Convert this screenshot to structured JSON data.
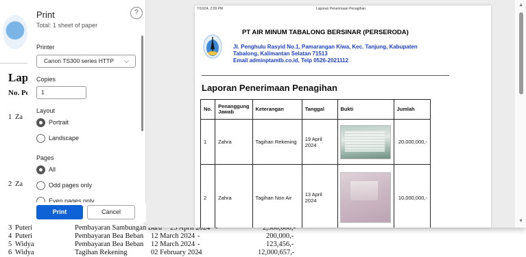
{
  "background": {
    "heading": "Lapo",
    "col_head": "No. Pe",
    "rows_top": [
      {
        "no": "1",
        "name": "Za"
      },
      {
        "no": "2",
        "name": "Za"
      }
    ],
    "rows": [
      {
        "no": "3",
        "name": "Puteri",
        "keterangan": "Pembayaran Sambungan Baru",
        "tanggal": "25 April 2024",
        "bukti": "-",
        "jumlah": "2,300,000,-"
      },
      {
        "no": "4",
        "name": "Puteri",
        "keterangan": "Pembayaran Bea Beban",
        "tanggal": "12 March 2024",
        "bukti": "-",
        "jumlah": "200,000,-"
      },
      {
        "no": "5",
        "name": "Widya",
        "keterangan": "Pembayaran Bea Beban",
        "tanggal": "12 March 2024",
        "bukti": "-",
        "jumlah": "123,456,-"
      },
      {
        "no": "6",
        "name": "Widya",
        "keterangan": "Tagihan Rekening",
        "tanggal": "02 February 2024",
        "bukti": "-",
        "jumlah": "12,000,657,-"
      }
    ]
  },
  "dialog": {
    "title": "Print",
    "subtitle": "Total: 1 sheet of paper",
    "help": "?",
    "printer_label": "Printer",
    "printer_value": "Canon TS300 series HTTP",
    "copies_label": "Copies",
    "copies_value": "1",
    "layout_label": "Layout",
    "layout_options": [
      {
        "label": "Portrait",
        "selected": true
      },
      {
        "label": "Landscape",
        "selected": false
      }
    ],
    "pages_label": "Pages",
    "pages_options": [
      {
        "label": "All",
        "selected": true
      },
      {
        "label": "Odd pages only",
        "selected": false
      },
      {
        "label": "Even pages only",
        "selected": false
      }
    ],
    "print_button": "Print",
    "cancel_button": "Cancel"
  },
  "preview": {
    "header_left": "7/10/24, 2:09 PM",
    "header_center": "Laporan Penerimaan Penagihan",
    "company": "PT AIR MINUM TABALONG BERSINAR (PERSERODA)",
    "address": "Jl. Penghulu Rasyid No.1, Pamarangan Kiwa, Kec. Tanjung, Kabupaten Tabalong, Kalimantan Selatan 71513",
    "email": "Email adminptamtb.co.id, Telp 0526-2021112",
    "report_title": "Laporan Penerimaan Penagihan",
    "columns": [
      "No.",
      "Penanggung Jawab",
      "Keterangan",
      "Tanggal",
      "Bukti",
      "Jumlah"
    ],
    "rows": [
      {
        "no": "1",
        "pj": "Zahra",
        "keterangan": "Tagihan Rekening",
        "tanggal": "19 April 2024",
        "jumlah": "20,000,000,-"
      },
      {
        "no": "2",
        "pj": "Zahra",
        "keterangan": "Tagihan Non Air",
        "tanggal": "13 April 2024",
        "jumlah": "10,000,000,-"
      }
    ]
  },
  "colors": {
    "accent": "#0f62d6",
    "address_blue": "#1b3fc6"
  },
  "icons": [
    "help-icon",
    "chevron-down-icon",
    "company-logo",
    "scroll-up-icon",
    "scroll-down-icon"
  ]
}
